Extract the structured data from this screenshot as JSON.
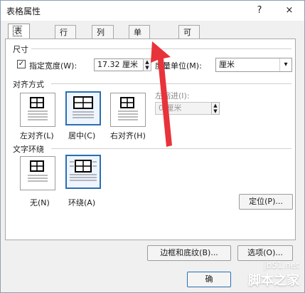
{
  "window": {
    "title": "表格属性",
    "help": "?",
    "close": "×"
  },
  "tabs": [
    {
      "label": "表格(T)"
    },
    {
      "label": "行(R)"
    },
    {
      "label": "列(U)"
    },
    {
      "label": "单元格(E)"
    },
    {
      "label": "可选文字(A)"
    }
  ],
  "size": {
    "section_title": "尺寸",
    "checkbox_checked": true,
    "preferred_width_label": "指定宽度(W):",
    "preferred_width_value": "17.32 厘米",
    "measure_label": "度量单位(M):",
    "measure_value": "厘米"
  },
  "alignment": {
    "section_title": "对齐方式",
    "options": [
      {
        "label": "左对齐(L)"
      },
      {
        "label": "居中(C)"
      },
      {
        "label": "右对齐(H)"
      }
    ],
    "indent_label": "左缩进(I):",
    "indent_value": "0 厘米"
  },
  "wrapping": {
    "section_title": "文字环绕",
    "options": [
      {
        "label": "无(N)"
      },
      {
        "label": "环绕(A)"
      }
    ],
    "positioning_button": "定位(P)..."
  },
  "bottom_buttons": {
    "borders_shading": "边框和底纹(B)...",
    "options": "选项(O)...",
    "ok_partial": "确"
  },
  "watermark": {
    "url": "jb51.net",
    "brand": "脚本之家"
  },
  "colors": {
    "accent": "#2a6fb2",
    "annotation_red": "#e8333a"
  }
}
